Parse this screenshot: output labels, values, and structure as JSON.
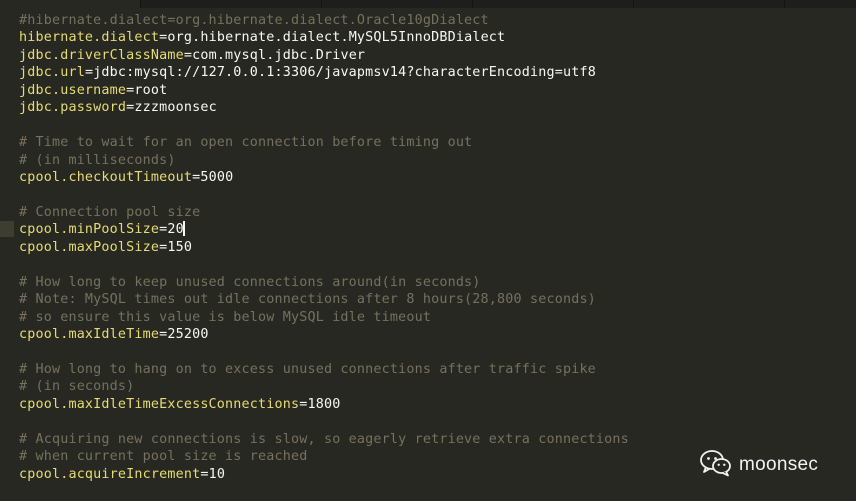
{
  "editor": {
    "lines": [
      {
        "parts": [
          {
            "cls": "c",
            "text": "#hibernate.dialect=org.hibernate.dialect.Oracle10gDialect"
          }
        ]
      },
      {
        "parts": [
          {
            "cls": "k",
            "text": "hibernate.dialect"
          },
          {
            "cls": "eq",
            "text": "="
          },
          {
            "cls": "v",
            "text": "org.hibernate.dialect.MySQL5InnoDBDialect"
          }
        ]
      },
      {
        "parts": [
          {
            "cls": "k",
            "text": "jdbc.driverClassName"
          },
          {
            "cls": "eq",
            "text": "="
          },
          {
            "cls": "v",
            "text": "com.mysql.jdbc.Driver"
          }
        ]
      },
      {
        "parts": [
          {
            "cls": "k",
            "text": "jdbc.url"
          },
          {
            "cls": "eq",
            "text": "="
          },
          {
            "cls": "v",
            "text": "jdbc:mysql://127.0.0.1:3306/javapmsv14?characterEncoding=utf8"
          }
        ]
      },
      {
        "parts": [
          {
            "cls": "k",
            "text": "jdbc.username"
          },
          {
            "cls": "eq",
            "text": "="
          },
          {
            "cls": "v",
            "text": "root"
          }
        ]
      },
      {
        "parts": [
          {
            "cls": "k",
            "text": "jdbc.password"
          },
          {
            "cls": "eq",
            "text": "="
          },
          {
            "cls": "v",
            "text": "zzzmoonsec"
          }
        ]
      },
      {
        "parts": []
      },
      {
        "parts": [
          {
            "cls": "c",
            "text": "# Time to wait for an open connection before timing out"
          }
        ]
      },
      {
        "parts": [
          {
            "cls": "c",
            "text": "# (in milliseconds)"
          }
        ]
      },
      {
        "parts": [
          {
            "cls": "k",
            "text": "cpool.checkoutTimeout"
          },
          {
            "cls": "eq",
            "text": "="
          },
          {
            "cls": "v",
            "text": "5000"
          }
        ]
      },
      {
        "parts": []
      },
      {
        "parts": [
          {
            "cls": "c",
            "text": "# Connection pool size"
          }
        ]
      },
      {
        "parts": [
          {
            "cls": "k",
            "text": "cpool.minPoolSize"
          },
          {
            "cls": "eq",
            "text": "="
          },
          {
            "cls": "v",
            "text": "20"
          }
        ],
        "current": true
      },
      {
        "parts": [
          {
            "cls": "k",
            "text": "cpool.maxPoolSize"
          },
          {
            "cls": "eq",
            "text": "="
          },
          {
            "cls": "v",
            "text": "150"
          }
        ]
      },
      {
        "parts": []
      },
      {
        "parts": [
          {
            "cls": "c",
            "text": "# How long to keep unused connections around(in seconds)"
          }
        ]
      },
      {
        "parts": [
          {
            "cls": "c",
            "text": "# Note: MySQL times out idle connections after 8 hours(28,800 seconds)"
          }
        ]
      },
      {
        "parts": [
          {
            "cls": "c",
            "text": "# so ensure this value is below MySQL idle timeout"
          }
        ]
      },
      {
        "parts": [
          {
            "cls": "k",
            "text": "cpool.maxIdleTime"
          },
          {
            "cls": "eq",
            "text": "="
          },
          {
            "cls": "v",
            "text": "25200"
          }
        ]
      },
      {
        "parts": []
      },
      {
        "parts": [
          {
            "cls": "c",
            "text": "# How long to hang on to excess unused connections after traffic spike"
          }
        ]
      },
      {
        "parts": [
          {
            "cls": "c",
            "text": "# (in seconds)"
          }
        ]
      },
      {
        "parts": [
          {
            "cls": "k",
            "text": "cpool.maxIdleTimeExcessConnections"
          },
          {
            "cls": "eq",
            "text": "="
          },
          {
            "cls": "v",
            "text": "1800"
          }
        ]
      },
      {
        "parts": []
      },
      {
        "parts": [
          {
            "cls": "c",
            "text": "# Acquiring new connections is slow, so eagerly retrieve extra connections"
          }
        ]
      },
      {
        "parts": [
          {
            "cls": "c",
            "text": "# when current pool size is reached"
          }
        ]
      },
      {
        "parts": [
          {
            "cls": "k",
            "text": "cpool.acquireIncrement"
          },
          {
            "cls": "eq",
            "text": "="
          },
          {
            "cls": "v",
            "text": "10"
          }
        ]
      }
    ]
  },
  "watermark": {
    "text": "moonsec",
    "icon": "wechat-icon"
  },
  "colors": {
    "background": "#272822",
    "comment": "#75715e",
    "key": "#e6db74",
    "text": "#f8f8f2"
  }
}
